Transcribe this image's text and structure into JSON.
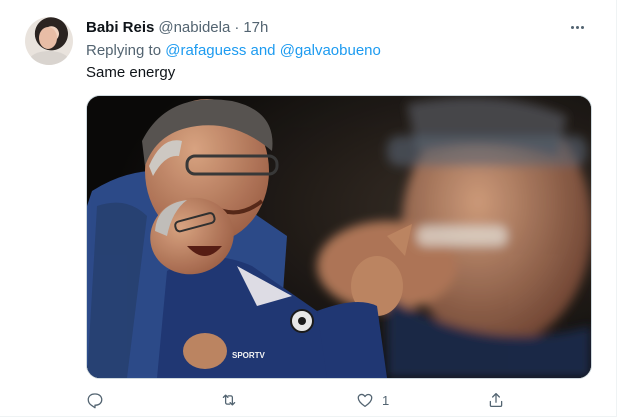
{
  "tweet": {
    "author_name": "Babi Reis",
    "handle": "@nabidela",
    "separator": "·",
    "time": "17h",
    "reply_prefix": "Replying to",
    "mention_1": "@rafaguess",
    "reply_and": "and",
    "mention_2": "@galvaobueno",
    "text": "Same energy",
    "media_watermark": "SPORTV",
    "actions": {
      "reply_icon": "reply-icon",
      "retweet_icon": "retweet-icon",
      "like_icon": "heart-icon",
      "like_count": "1",
      "share_icon": "share-icon"
    }
  },
  "colors": {
    "text": "#0f1419",
    "secondary": "#536471",
    "link": "#1d9bf0",
    "border": "#cfd9de"
  }
}
